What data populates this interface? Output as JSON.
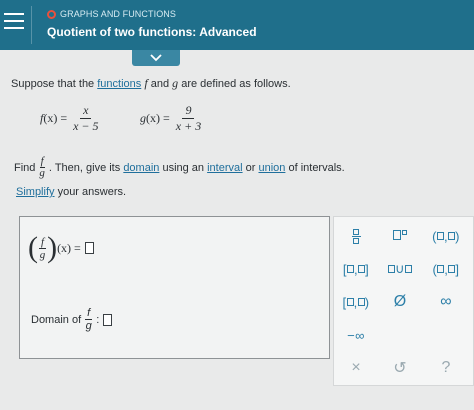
{
  "header": {
    "topic": "GRAPHS AND FUNCTIONS",
    "title": "Quotient of two functions: Advanced"
  },
  "colors": {
    "header_bg": "#1f6f8b",
    "topic_dot": "#e9503d",
    "link": "#1f6f9c",
    "keypad_symbol": "#2c7fa8"
  },
  "problem": {
    "intro_before": "Suppose that the ",
    "intro_link": "functions",
    "intro_mid1": " ",
    "f": "f",
    "intro_mid2": " and ",
    "g": "g",
    "intro_after": " are defined as follows.",
    "f_def": {
      "name": "f",
      "arg": "(x) =",
      "numerator": "x",
      "denominator": "x − 5"
    },
    "g_def": {
      "name": "g",
      "arg": "(x) =",
      "numerator": "9",
      "denominator": "x + 3"
    },
    "find_label": "Find",
    "quot_num": "f",
    "quot_den": "g",
    "then_text": ". Then, give its",
    "domain_link": "domain",
    "using_text": "using an",
    "interval_link": "interval",
    "or_text": "or",
    "union_link": "union",
    "of_text": "of intervals.",
    "simplify_link": "Simplify",
    "simplify_rest": " your answers."
  },
  "answer": {
    "quot_num": "f",
    "quot_den": "g",
    "arg": "(x) =",
    "domain_label": "Domain of",
    "domain_colon": ":"
  },
  "keypad": {
    "empty_set": "Ø",
    "infinity": "∞",
    "neg_infinity": "−∞",
    "clear": "×",
    "undo": "↺",
    "help": "?",
    "open_open_l": "(",
    "open_open_r": ")",
    "closed_closed_l": "[",
    "closed_closed_r": "]",
    "open_closed_l": "(",
    "open_closed_r": "]",
    "closed_open_l": "[",
    "closed_open_r": ")",
    "union": "∪"
  }
}
